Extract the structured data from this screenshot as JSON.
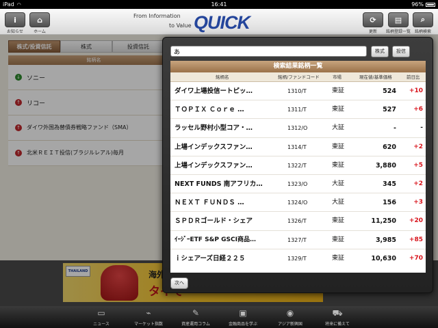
{
  "status": {
    "device": "iPad",
    "time": "16:41",
    "battery": "96%"
  },
  "header": {
    "left_buttons": [
      {
        "label": "お知らせ",
        "icon": "info-icon"
      },
      {
        "label": "ホーム",
        "icon": "home-icon"
      }
    ],
    "logo": {
      "line1": "From Information",
      "line2": "to Value",
      "brand": "QUICK"
    },
    "right_buttons": [
      {
        "label": "更新",
        "icon": "refresh-icon"
      },
      {
        "label": "銘柄登録一覧",
        "icon": "list-icon"
      },
      {
        "label": "銘柄検索",
        "icon": "search-icon"
      }
    ]
  },
  "background": {
    "tabs": [
      "株式/投資信託",
      "株式",
      "投資信託"
    ],
    "table_header": "銘柄名",
    "rows": [
      {
        "name": "ソニー",
        "direction": "down"
      },
      {
        "name": "リコー",
        "direction": "up"
      },
      {
        "name": "ダイワ外国為替債券戦略ファンド（SMA）",
        "direction": "up"
      },
      {
        "name": "北米ＲＥＩＴ投信(ブラジルレアル)毎月",
        "direction": "up"
      }
    ]
  },
  "banner": {
    "badge": "THAILAND",
    "line1": "海外ゴル",
    "line2": "タイで"
  },
  "bottom_nav": [
    {
      "label": "ニュース",
      "icon": "news-icon"
    },
    {
      "label": "マーケット指数",
      "icon": "chart-icon"
    },
    {
      "label": "資産運用コラム",
      "icon": "column-icon"
    },
    {
      "label": "金融商品を学ぶ",
      "icon": "book-icon"
    },
    {
      "label": "アジア新興国",
      "icon": "globe-icon"
    },
    {
      "label": "将来に備えて",
      "icon": "future-icon"
    }
  ],
  "search": {
    "query": "あ",
    "buttons": {
      "stock": "株式",
      "fund": "投信"
    },
    "results_title": "検索結果銘柄一覧",
    "columns": {
      "name": "銘柄名",
      "code": "銘柄/ファンドコード",
      "market": "市場",
      "price": "現在値/基準価格",
      "change": "前日比"
    },
    "rows": [
      {
        "name": "ダイワ上場投信ートピッ…",
        "code": "1310/T",
        "market": "東証",
        "price": "524",
        "change": "+10"
      },
      {
        "name": "ＴＯＰＩＸ Ｃｏｒｅ …",
        "code": "1311/T",
        "market": "東証",
        "price": "527",
        "change": "+6"
      },
      {
        "name": "ラッセル野村小型コア・…",
        "code": "1312/O",
        "market": "大証",
        "price": "-",
        "change": "-"
      },
      {
        "name": "上場インデックスファン…",
        "code": "1314/T",
        "market": "東証",
        "price": "620",
        "change": "+2"
      },
      {
        "name": "上場インデックスファン…",
        "code": "1322/T",
        "market": "東証",
        "price": "3,880",
        "change": "+5"
      },
      {
        "name": "NEXT FUNDS 南アフリカ…",
        "code": "1323/O",
        "market": "大証",
        "price": "345",
        "change": "+2"
      },
      {
        "name": "ＮＥＸＴ ＦＵＮＤＳ …",
        "code": "1324/O",
        "market": "大証",
        "price": "156",
        "change": "+3"
      },
      {
        "name": "ＳＰＤＲゴールド・シェア",
        "code": "1326/T",
        "market": "東証",
        "price": "11,250",
        "change": "+20"
      },
      {
        "name": "ｲｰｼﾞｰETF S&P GSCI商品…",
        "code": "1327/T",
        "market": "東証",
        "price": "3,985",
        "change": "+85"
      },
      {
        "name": "ｉシェアーズ日経２２５",
        "code": "1329/T",
        "market": "東証",
        "price": "10,630",
        "change": "+70"
      }
    ],
    "next_label": "次へ"
  }
}
